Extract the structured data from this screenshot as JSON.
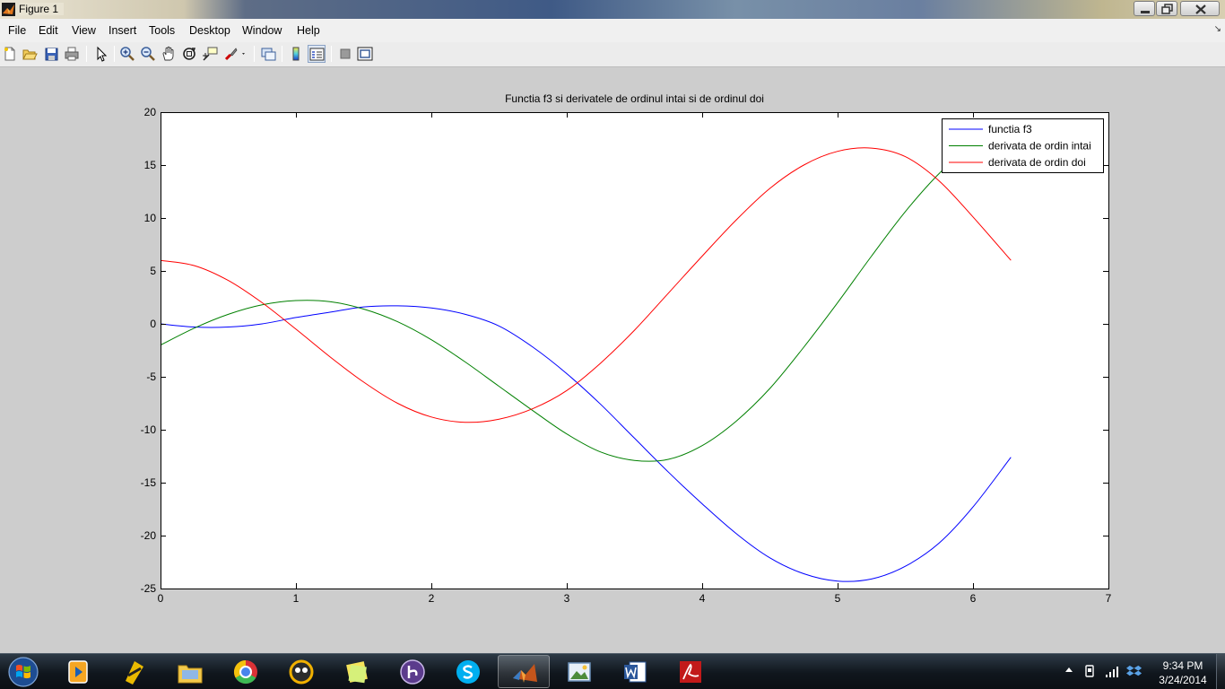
{
  "window": {
    "title": "Figure 1"
  },
  "menubar": {
    "items": [
      "File",
      "Edit",
      "View",
      "Insert",
      "Tools",
      "Desktop",
      "Window",
      "Help"
    ],
    "corner_glyph": "↘"
  },
  "toolbar": {
    "buttons": [
      "new-figure-icon",
      "open-file-icon",
      "save-icon",
      "print-icon",
      "edit-plot-arrow-icon",
      "zoom-in-icon",
      "zoom-out-icon",
      "pan-hand-icon",
      "rotate-3d-icon",
      "data-cursor-icon",
      "brush-icon",
      "link-plot-icon",
      "insert-colorbar-icon",
      "insert-legend-icon",
      "hide-plot-tools-icon",
      "show-plot-tools-icon"
    ]
  },
  "chart_data": {
    "type": "line",
    "title": "Functia f3 si derivatele de ordinul intai si de ordinul doi",
    "xlabel": "",
    "ylabel": "",
    "xlim": [
      0,
      7
    ],
    "ylim": [
      -25,
      20
    ],
    "xticks": [
      0,
      1,
      2,
      3,
      4,
      5,
      6,
      7
    ],
    "yticks": [
      20,
      15,
      10,
      5,
      0,
      -5,
      -10,
      -15,
      -20,
      -25
    ],
    "grid": false,
    "legend_position": "top-right",
    "series": [
      {
        "name": "functia f3",
        "color": "#0000ff",
        "x": [
          0,
          0.25,
          0.5,
          0.75,
          1,
          1.25,
          1.5,
          1.75,
          2,
          2.25,
          2.5,
          2.75,
          3,
          3.25,
          3.5,
          3.75,
          4,
          4.25,
          4.5,
          4.75,
          5,
          5.25,
          5.5,
          5.75,
          6,
          6.28
        ],
        "y": [
          0,
          -0.3,
          -0.3,
          0,
          0.6,
          1.1,
          1.6,
          1.7,
          1.5,
          0.9,
          -0.2,
          -2.2,
          -4.7,
          -7.6,
          -10.8,
          -14,
          -17,
          -19.8,
          -22.1,
          -23.6,
          -24.3,
          -24.1,
          -22.9,
          -20.7,
          -17.3,
          -12.6
        ]
      },
      {
        "name": "derivata de ordin intai",
        "color": "#008000",
        "x": [
          0,
          0.25,
          0.5,
          0.75,
          1,
          1.25,
          1.5,
          1.75,
          2,
          2.25,
          2.5,
          2.75,
          3,
          3.25,
          3.5,
          3.75,
          4,
          4.25,
          4.5,
          4.75,
          5,
          5.25,
          5.5,
          5.75,
          6,
          6.28
        ],
        "y": [
          -2,
          -0.4,
          0.9,
          1.8,
          2.2,
          2.1,
          1.4,
          0.2,
          -1.5,
          -3.6,
          -5.9,
          -8.2,
          -10.4,
          -12.1,
          -12.9,
          -12.8,
          -11.5,
          -9.2,
          -6.1,
          -2.2,
          2,
          6.4,
          10.6,
          14.2,
          17,
          18.5
        ]
      },
      {
        "name": "derivata de ordin doi",
        "color": "#ff0000",
        "x": [
          0,
          0.25,
          0.5,
          0.75,
          1,
          1.25,
          1.5,
          1.75,
          2,
          2.25,
          2.5,
          2.75,
          3,
          3.25,
          3.5,
          3.75,
          4,
          4.25,
          4.5,
          4.75,
          5,
          5.25,
          5.5,
          5.75,
          6,
          6.28
        ],
        "y": [
          6,
          5.5,
          4.1,
          2,
          -0.5,
          -3.1,
          -5.5,
          -7.5,
          -8.8,
          -9.3,
          -9,
          -8,
          -6.3,
          -3.7,
          -0.6,
          2.9,
          6.4,
          9.8,
          12.8,
          15,
          16.3,
          16.6,
          15.8,
          13.5,
          10.1,
          6
        ]
      }
    ]
  },
  "taskbar": {
    "apps": [
      "media-player-icon",
      "winamp-icon",
      "file-explorer-icon",
      "chrome-icon",
      "gom-player-icon",
      "sticky-notes-icon",
      "bittorrent-icon",
      "skype-icon",
      "matlab-icon",
      "photo-viewer-icon",
      "word-icon",
      "acrobat-icon"
    ],
    "active_app": "matlab-icon",
    "clock": {
      "time": "9:34 PM",
      "date": "3/24/2014"
    }
  }
}
